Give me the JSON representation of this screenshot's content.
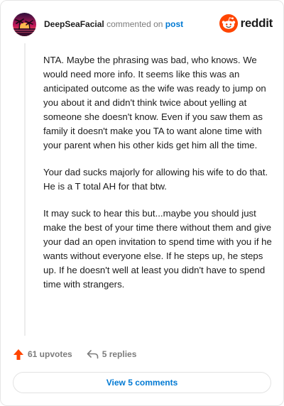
{
  "comment": {
    "username": "DeepSeaFacial",
    "commented_on": "commented on",
    "post_link": "post",
    "paragraphs": [
      "NTA. Maybe the phrasing was bad, who knows. We would need more info. It seems like this was an anticipated outcome as the wife was ready to jump on you about it and didn't think twice about yelling at someone she doesn't know. Even if you saw them as family it doesn't make you TA to want alone time with your parent when his other kids get him all the time.",
      "Your dad sucks majorly for allowing his wife to do that. He is a T total AH for that btw.",
      "It may suck to hear this but...maybe you should just make the best of your time there without them and give your dad an open invitation to spend time with you if he wants without everyone else. If he steps up, he steps up. If he doesn't well at least you didn't have to spend time with strangers."
    ],
    "upvotes": "61 upvotes",
    "replies": "5 replies",
    "view_comments": "View 5 comments"
  },
  "brand": {
    "wordmark": "reddit",
    "icon": "reddit-snoo-icon",
    "orange": "#ff4500"
  },
  "colors": {
    "link": "#0079d3",
    "muted": "#7c7c7c",
    "upvote": "#ff4500"
  }
}
